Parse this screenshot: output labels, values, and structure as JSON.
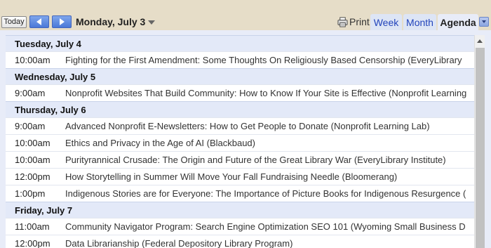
{
  "toolbar": {
    "today_label": "Today",
    "date_label": "Monday, July 3",
    "print_label": "Print",
    "tabs": [
      {
        "label": "Week"
      },
      {
        "label": "Month"
      },
      {
        "label": "Agenda"
      }
    ]
  },
  "agenda": {
    "days": [
      {
        "header": "Tuesday, July 4",
        "events": [
          {
            "time": "10:00am",
            "title": "Fighting for the First Amendment: Some Thoughts On Religiously Based Censorship (EveryLibrary"
          }
        ]
      },
      {
        "header": "Wednesday, July 5",
        "events": [
          {
            "time": "9:00am",
            "title": "Nonprofit Websites That Build Community: How to Know If Your Site is Effective (Nonprofit Learning"
          }
        ]
      },
      {
        "header": "Thursday, July 6",
        "events": [
          {
            "time": "9:00am",
            "title": "Advanced Nonprofit E-Newsletters: How to Get People to Donate (Nonprofit Learning Lab)"
          },
          {
            "time": "10:00am",
            "title": "Ethics and Privacy in the Age of AI (Blackbaud)"
          },
          {
            "time": "10:00am",
            "title": "Purityrannical Crusade: The Origin and Future of the Great Library War (EveryLibrary Institute)"
          },
          {
            "time": "12:00pm",
            "title": "How Storytelling in Summer Will Move Your Fall Fundraising Needle (Bloomerang)"
          },
          {
            "time": "1:00pm",
            "title": "Indigenous Stories are for Everyone: The Importance of Picture Books for Indigenous Resurgence ("
          }
        ]
      },
      {
        "header": "Friday, July 7",
        "events": [
          {
            "time": "11:00am",
            "title": "Community Navigator Program: Search Engine Optimization SEO 101 (Wyoming Small Business D"
          },
          {
            "time": "12:00pm",
            "title": "Data Librarianship (Federal Depository Library Program)"
          }
        ]
      }
    ]
  }
}
